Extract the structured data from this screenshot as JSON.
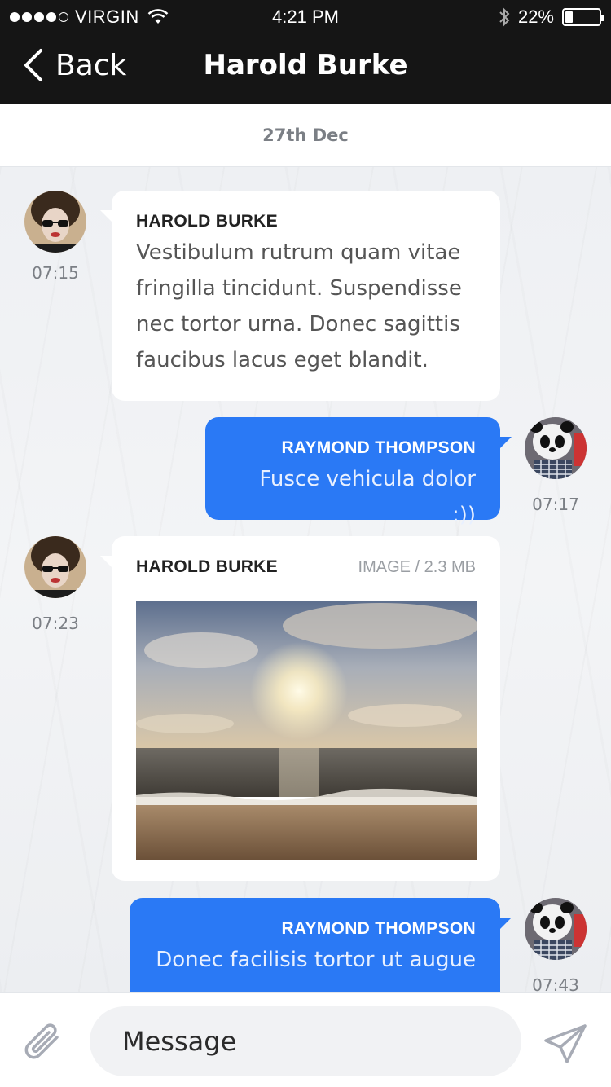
{
  "status_bar": {
    "carrier": "VIRGIN",
    "time": "4:21 PM",
    "battery": "22%"
  },
  "nav": {
    "back_label": "Back",
    "title": "Harold Burke"
  },
  "date_header": "27th Dec",
  "messages": [
    {
      "direction": "incoming",
      "sender": "HAROLD BURKE",
      "text": "Vestibulum rutrum quam vitae fringilla tincidunt. Suspendisse nec tortor urna. Donec sagittis faucibus lacus eget blandit.",
      "time": "07:15"
    },
    {
      "direction": "outgoing",
      "sender": "RAYMOND THOMPSON",
      "text": "Fusce vehicula dolor :))",
      "time": "07:17"
    },
    {
      "direction": "incoming",
      "sender": "HAROLD BURKE",
      "attachment_meta": "IMAGE / 2.3 MB",
      "attachment_type": "image",
      "time": "07:23"
    },
    {
      "direction": "outgoing",
      "sender": "RAYMOND THOMPSON",
      "text": "Donec facilisis tortor ut augue",
      "time": "07:43"
    }
  ],
  "composer": {
    "placeholder": "Message"
  },
  "colors": {
    "bar_background": "#151515",
    "outgoing_bubble": "#2a79f5",
    "incoming_bubble": "#ffffff"
  }
}
